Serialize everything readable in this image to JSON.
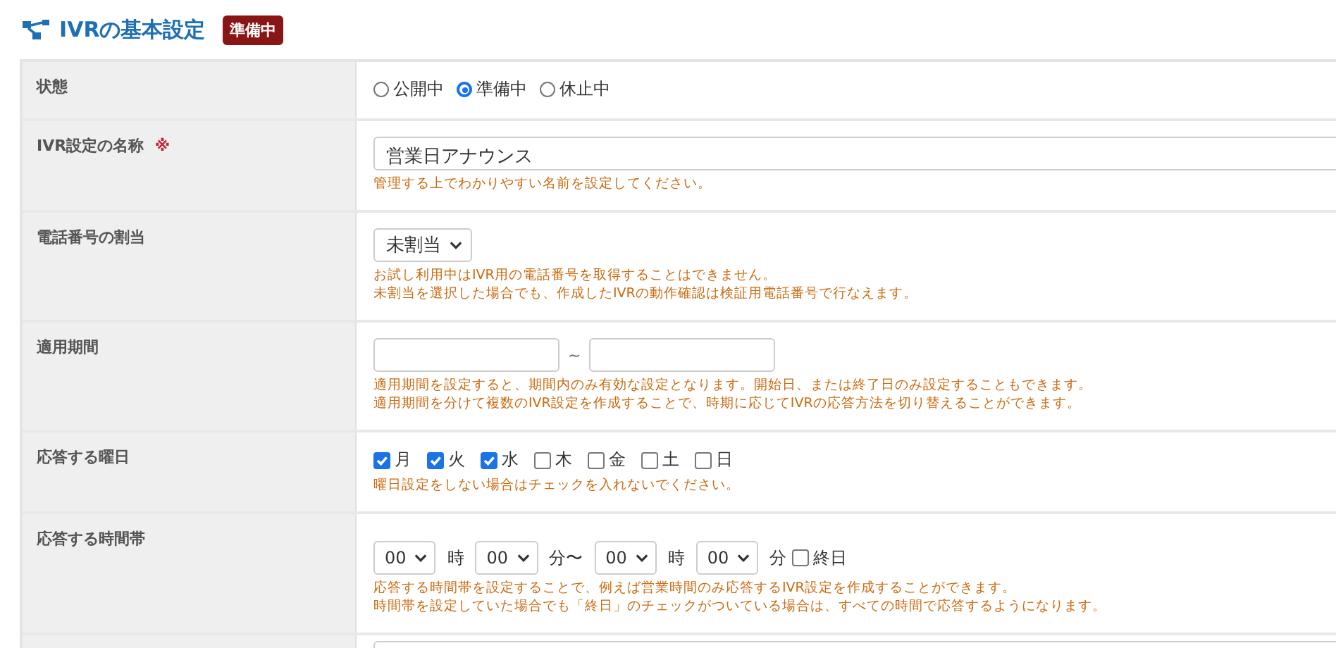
{
  "title": "IVRの基本設定",
  "status_badge": "準備中",
  "rows": [
    {
      "kind": "radio",
      "label": "状態",
      "options": [
        {
          "label": "公開中",
          "selected": false
        },
        {
          "label": "準備中",
          "selected": true
        },
        {
          "label": "休止中",
          "selected": false
        }
      ]
    },
    {
      "kind": "text",
      "label": "IVR設定の名称",
      "required_mark": "※",
      "value": "営業日アナウンス",
      "hints": [
        "管理する上でわかりやすい名前を設定してください。"
      ]
    },
    {
      "kind": "select",
      "label": "電話番号の割当",
      "value": "未割当",
      "hints": [
        "お試し利用中はIVR用の電話番号を取得することはできません。",
        "未割当を選択した場合でも、作成したIVRの動作確認は検証用電話番号で行なえます。"
      ]
    },
    {
      "kind": "date_range",
      "label": "適用期間",
      "separator": "~",
      "hints": [
        "適用期間を設定すると、期間内のみ有効な設定となります。開始日、または終了日のみ設定することもできます。",
        "適用期間を分けて複数のIVR設定を作成することで、時期に応じてIVRの応答方法を切り替えることができます。"
      ]
    },
    {
      "kind": "weekdays",
      "label": "応答する曜日",
      "days": [
        {
          "label": "月",
          "checked": true
        },
        {
          "label": "火",
          "checked": true
        },
        {
          "label": "水",
          "checked": true
        },
        {
          "label": "木",
          "checked": false
        },
        {
          "label": "金",
          "checked": false
        },
        {
          "label": "土",
          "checked": false
        },
        {
          "label": "日",
          "checked": false
        }
      ],
      "hints": [
        "曜日設定をしない場合はチェックを入れないでください。"
      ]
    },
    {
      "kind": "time_range",
      "label": "応答する時間帯",
      "controls": [
        {
          "kind": "select",
          "value": "00"
        },
        {
          "kind": "unit",
          "text": "時"
        },
        {
          "kind": "select",
          "value": "00"
        },
        {
          "kind": "unit",
          "text": "分〜"
        },
        {
          "kind": "select",
          "value": "00"
        },
        {
          "kind": "unit",
          "text": "時"
        },
        {
          "kind": "select",
          "value": "00"
        },
        {
          "kind": "unit",
          "text": "分"
        },
        {
          "kind": "checkbox",
          "label": "終日",
          "checked": false
        }
      ],
      "hints": [
        "応答する時間帯を設定することで、例えば営業時間のみ応答するIVR設定を作成することができます。",
        "時間帯を設定していた場合でも「終日」のチェックがついている場合は、すべての時間で応答するようになります。"
      ]
    },
    {
      "kind": "textarea"
    }
  ]
}
